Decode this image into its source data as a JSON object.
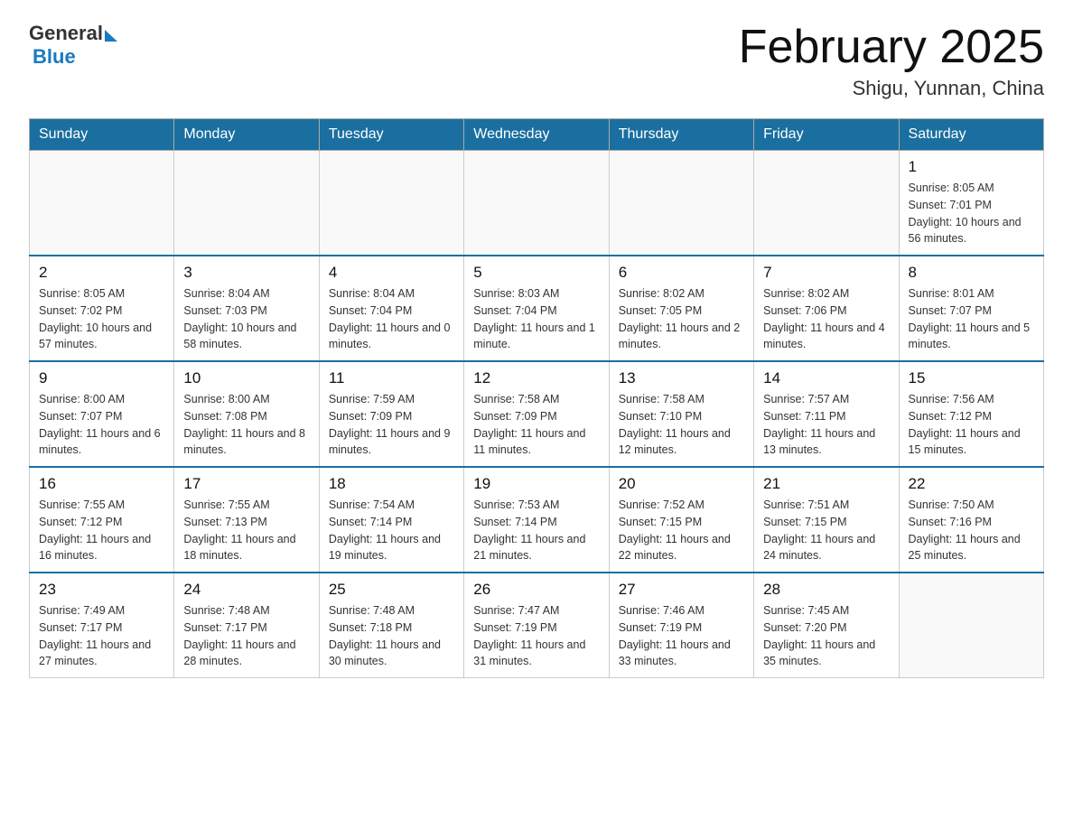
{
  "header": {
    "logo_general": "General",
    "logo_blue": "Blue",
    "month": "February 2025",
    "location": "Shigu, Yunnan, China"
  },
  "days_of_week": [
    "Sunday",
    "Monday",
    "Tuesday",
    "Wednesday",
    "Thursday",
    "Friday",
    "Saturday"
  ],
  "weeks": [
    [
      {
        "day": "",
        "sunrise": "",
        "sunset": "",
        "daylight": ""
      },
      {
        "day": "",
        "sunrise": "",
        "sunset": "",
        "daylight": ""
      },
      {
        "day": "",
        "sunrise": "",
        "sunset": "",
        "daylight": ""
      },
      {
        "day": "",
        "sunrise": "",
        "sunset": "",
        "daylight": ""
      },
      {
        "day": "",
        "sunrise": "",
        "sunset": "",
        "daylight": ""
      },
      {
        "day": "",
        "sunrise": "",
        "sunset": "",
        "daylight": ""
      },
      {
        "day": "1",
        "sunrise": "Sunrise: 8:05 AM",
        "sunset": "Sunset: 7:01 PM",
        "daylight": "Daylight: 10 hours and 56 minutes."
      }
    ],
    [
      {
        "day": "2",
        "sunrise": "Sunrise: 8:05 AM",
        "sunset": "Sunset: 7:02 PM",
        "daylight": "Daylight: 10 hours and 57 minutes."
      },
      {
        "day": "3",
        "sunrise": "Sunrise: 8:04 AM",
        "sunset": "Sunset: 7:03 PM",
        "daylight": "Daylight: 10 hours and 58 minutes."
      },
      {
        "day": "4",
        "sunrise": "Sunrise: 8:04 AM",
        "sunset": "Sunset: 7:04 PM",
        "daylight": "Daylight: 11 hours and 0 minutes."
      },
      {
        "day": "5",
        "sunrise": "Sunrise: 8:03 AM",
        "sunset": "Sunset: 7:04 PM",
        "daylight": "Daylight: 11 hours and 1 minute."
      },
      {
        "day": "6",
        "sunrise": "Sunrise: 8:02 AM",
        "sunset": "Sunset: 7:05 PM",
        "daylight": "Daylight: 11 hours and 2 minutes."
      },
      {
        "day": "7",
        "sunrise": "Sunrise: 8:02 AM",
        "sunset": "Sunset: 7:06 PM",
        "daylight": "Daylight: 11 hours and 4 minutes."
      },
      {
        "day": "8",
        "sunrise": "Sunrise: 8:01 AM",
        "sunset": "Sunset: 7:07 PM",
        "daylight": "Daylight: 11 hours and 5 minutes."
      }
    ],
    [
      {
        "day": "9",
        "sunrise": "Sunrise: 8:00 AM",
        "sunset": "Sunset: 7:07 PM",
        "daylight": "Daylight: 11 hours and 6 minutes."
      },
      {
        "day": "10",
        "sunrise": "Sunrise: 8:00 AM",
        "sunset": "Sunset: 7:08 PM",
        "daylight": "Daylight: 11 hours and 8 minutes."
      },
      {
        "day": "11",
        "sunrise": "Sunrise: 7:59 AM",
        "sunset": "Sunset: 7:09 PM",
        "daylight": "Daylight: 11 hours and 9 minutes."
      },
      {
        "day": "12",
        "sunrise": "Sunrise: 7:58 AM",
        "sunset": "Sunset: 7:09 PM",
        "daylight": "Daylight: 11 hours and 11 minutes."
      },
      {
        "day": "13",
        "sunrise": "Sunrise: 7:58 AM",
        "sunset": "Sunset: 7:10 PM",
        "daylight": "Daylight: 11 hours and 12 minutes."
      },
      {
        "day": "14",
        "sunrise": "Sunrise: 7:57 AM",
        "sunset": "Sunset: 7:11 PM",
        "daylight": "Daylight: 11 hours and 13 minutes."
      },
      {
        "day": "15",
        "sunrise": "Sunrise: 7:56 AM",
        "sunset": "Sunset: 7:12 PM",
        "daylight": "Daylight: 11 hours and 15 minutes."
      }
    ],
    [
      {
        "day": "16",
        "sunrise": "Sunrise: 7:55 AM",
        "sunset": "Sunset: 7:12 PM",
        "daylight": "Daylight: 11 hours and 16 minutes."
      },
      {
        "day": "17",
        "sunrise": "Sunrise: 7:55 AM",
        "sunset": "Sunset: 7:13 PM",
        "daylight": "Daylight: 11 hours and 18 minutes."
      },
      {
        "day": "18",
        "sunrise": "Sunrise: 7:54 AM",
        "sunset": "Sunset: 7:14 PM",
        "daylight": "Daylight: 11 hours and 19 minutes."
      },
      {
        "day": "19",
        "sunrise": "Sunrise: 7:53 AM",
        "sunset": "Sunset: 7:14 PM",
        "daylight": "Daylight: 11 hours and 21 minutes."
      },
      {
        "day": "20",
        "sunrise": "Sunrise: 7:52 AM",
        "sunset": "Sunset: 7:15 PM",
        "daylight": "Daylight: 11 hours and 22 minutes."
      },
      {
        "day": "21",
        "sunrise": "Sunrise: 7:51 AM",
        "sunset": "Sunset: 7:15 PM",
        "daylight": "Daylight: 11 hours and 24 minutes."
      },
      {
        "day": "22",
        "sunrise": "Sunrise: 7:50 AM",
        "sunset": "Sunset: 7:16 PM",
        "daylight": "Daylight: 11 hours and 25 minutes."
      }
    ],
    [
      {
        "day": "23",
        "sunrise": "Sunrise: 7:49 AM",
        "sunset": "Sunset: 7:17 PM",
        "daylight": "Daylight: 11 hours and 27 minutes."
      },
      {
        "day": "24",
        "sunrise": "Sunrise: 7:48 AM",
        "sunset": "Sunset: 7:17 PM",
        "daylight": "Daylight: 11 hours and 28 minutes."
      },
      {
        "day": "25",
        "sunrise": "Sunrise: 7:48 AM",
        "sunset": "Sunset: 7:18 PM",
        "daylight": "Daylight: 11 hours and 30 minutes."
      },
      {
        "day": "26",
        "sunrise": "Sunrise: 7:47 AM",
        "sunset": "Sunset: 7:19 PM",
        "daylight": "Daylight: 11 hours and 31 minutes."
      },
      {
        "day": "27",
        "sunrise": "Sunrise: 7:46 AM",
        "sunset": "Sunset: 7:19 PM",
        "daylight": "Daylight: 11 hours and 33 minutes."
      },
      {
        "day": "28",
        "sunrise": "Sunrise: 7:45 AM",
        "sunset": "Sunset: 7:20 PM",
        "daylight": "Daylight: 11 hours and 35 minutes."
      },
      {
        "day": "",
        "sunrise": "",
        "sunset": "",
        "daylight": ""
      }
    ]
  ]
}
